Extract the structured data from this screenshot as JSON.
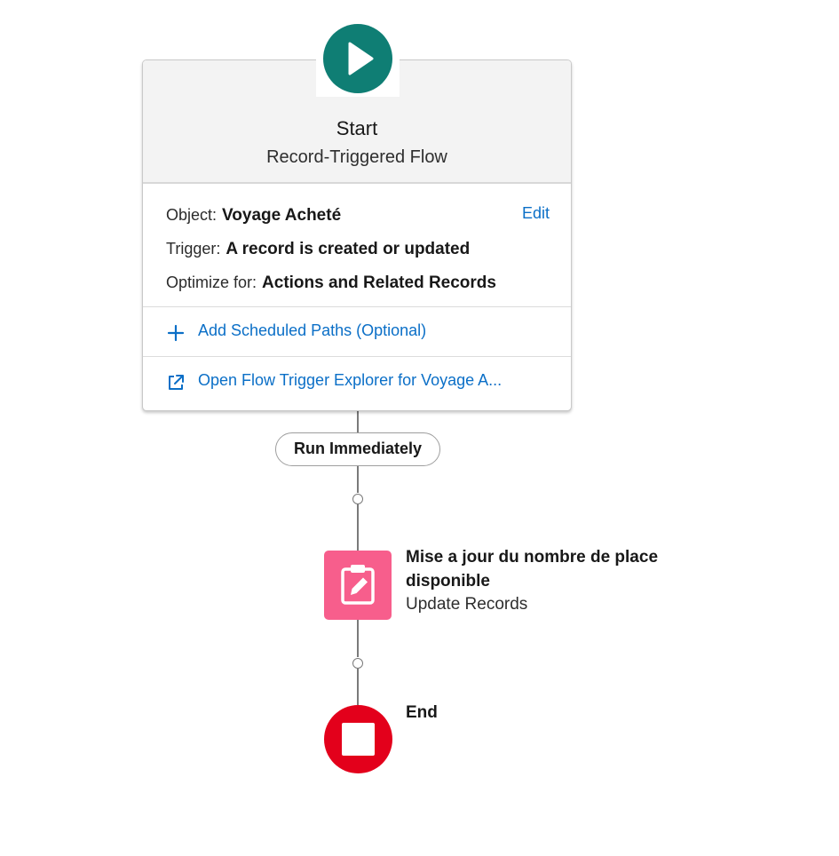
{
  "start": {
    "title": "Start",
    "subtitle": "Record-Triggered Flow",
    "object_label": "Object:",
    "object_value": "Voyage Acheté",
    "edit_label": "Edit",
    "trigger_label": "Trigger:",
    "trigger_value": "A record is created or updated",
    "optimize_label": "Optimize for:",
    "optimize_value": "Actions and Related Records",
    "scheduled_paths_label": "Add Scheduled Paths (Optional)",
    "explorer_label": "Open Flow Trigger Explorer for Voyage A..."
  },
  "path": {
    "run_label": "Run Immediately"
  },
  "update_element": {
    "title_line1": "Mise a jour du nombre de place",
    "title_line2": "disponible",
    "type": "Update Records"
  },
  "end_element": {
    "label": "End"
  },
  "icons": {
    "start": "play-icon",
    "add": "plus-icon",
    "external": "external-link-icon",
    "update": "clipboard-edit-icon",
    "end": "stop-icon"
  },
  "colors": {
    "start_green": "#0f7e74",
    "update_pink": "#f75e8c",
    "end_red": "#e3001b",
    "link_blue": "#0b6fc7"
  }
}
